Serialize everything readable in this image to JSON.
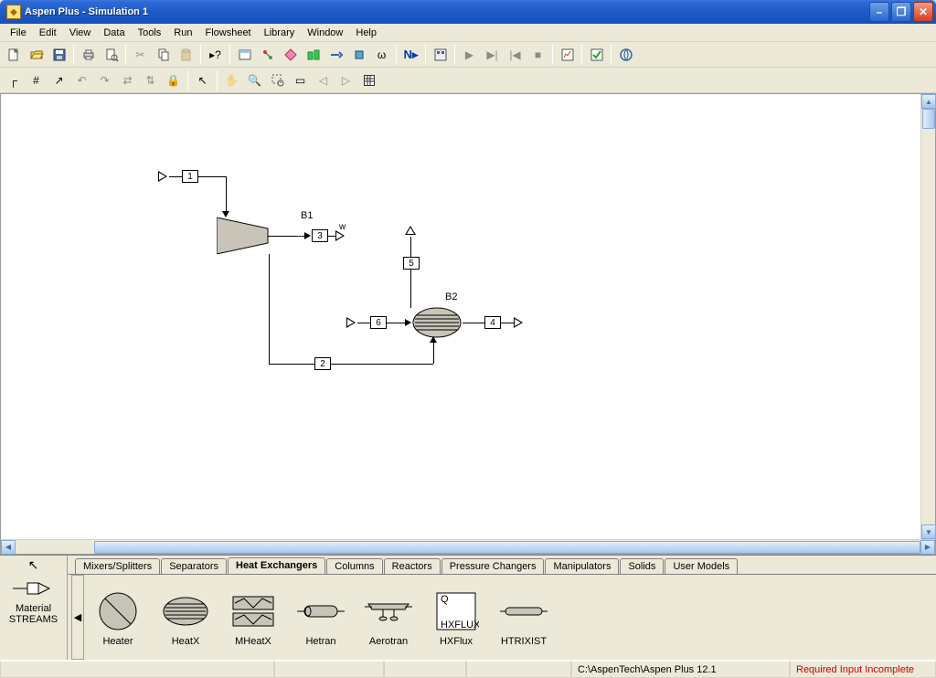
{
  "title": "Aspen Plus - Simulation 1",
  "menu": [
    "File",
    "Edit",
    "View",
    "Data",
    "Tools",
    "Run",
    "Flowsheet",
    "Library",
    "Window",
    "Help"
  ],
  "blocks": {
    "b1": "B1",
    "b2": "B2"
  },
  "streams": {
    "s1": "1",
    "s2": "2",
    "s3": "3",
    "s4": "4",
    "s5": "5",
    "s6": "6"
  },
  "model_tabs": [
    "Mixers/Splitters",
    "Separators",
    "Heat Exchangers",
    "Columns",
    "Reactors",
    "Pressure Changers",
    "Manipulators",
    "Solids",
    "User Models"
  ],
  "model_tabs_active": 2,
  "units": [
    "Heater",
    "HeatX",
    "MHeatX",
    "Hetran",
    "Aerotran",
    "HXFlux",
    "HTRIXIST"
  ],
  "left_unit": {
    "top": "Material",
    "bottom": "STREAMS"
  },
  "status": {
    "path": "C:\\AspenTech\\Aspen Plus 12.1",
    "msg": "Required Input Incomplete"
  },
  "next_label": "N▸"
}
